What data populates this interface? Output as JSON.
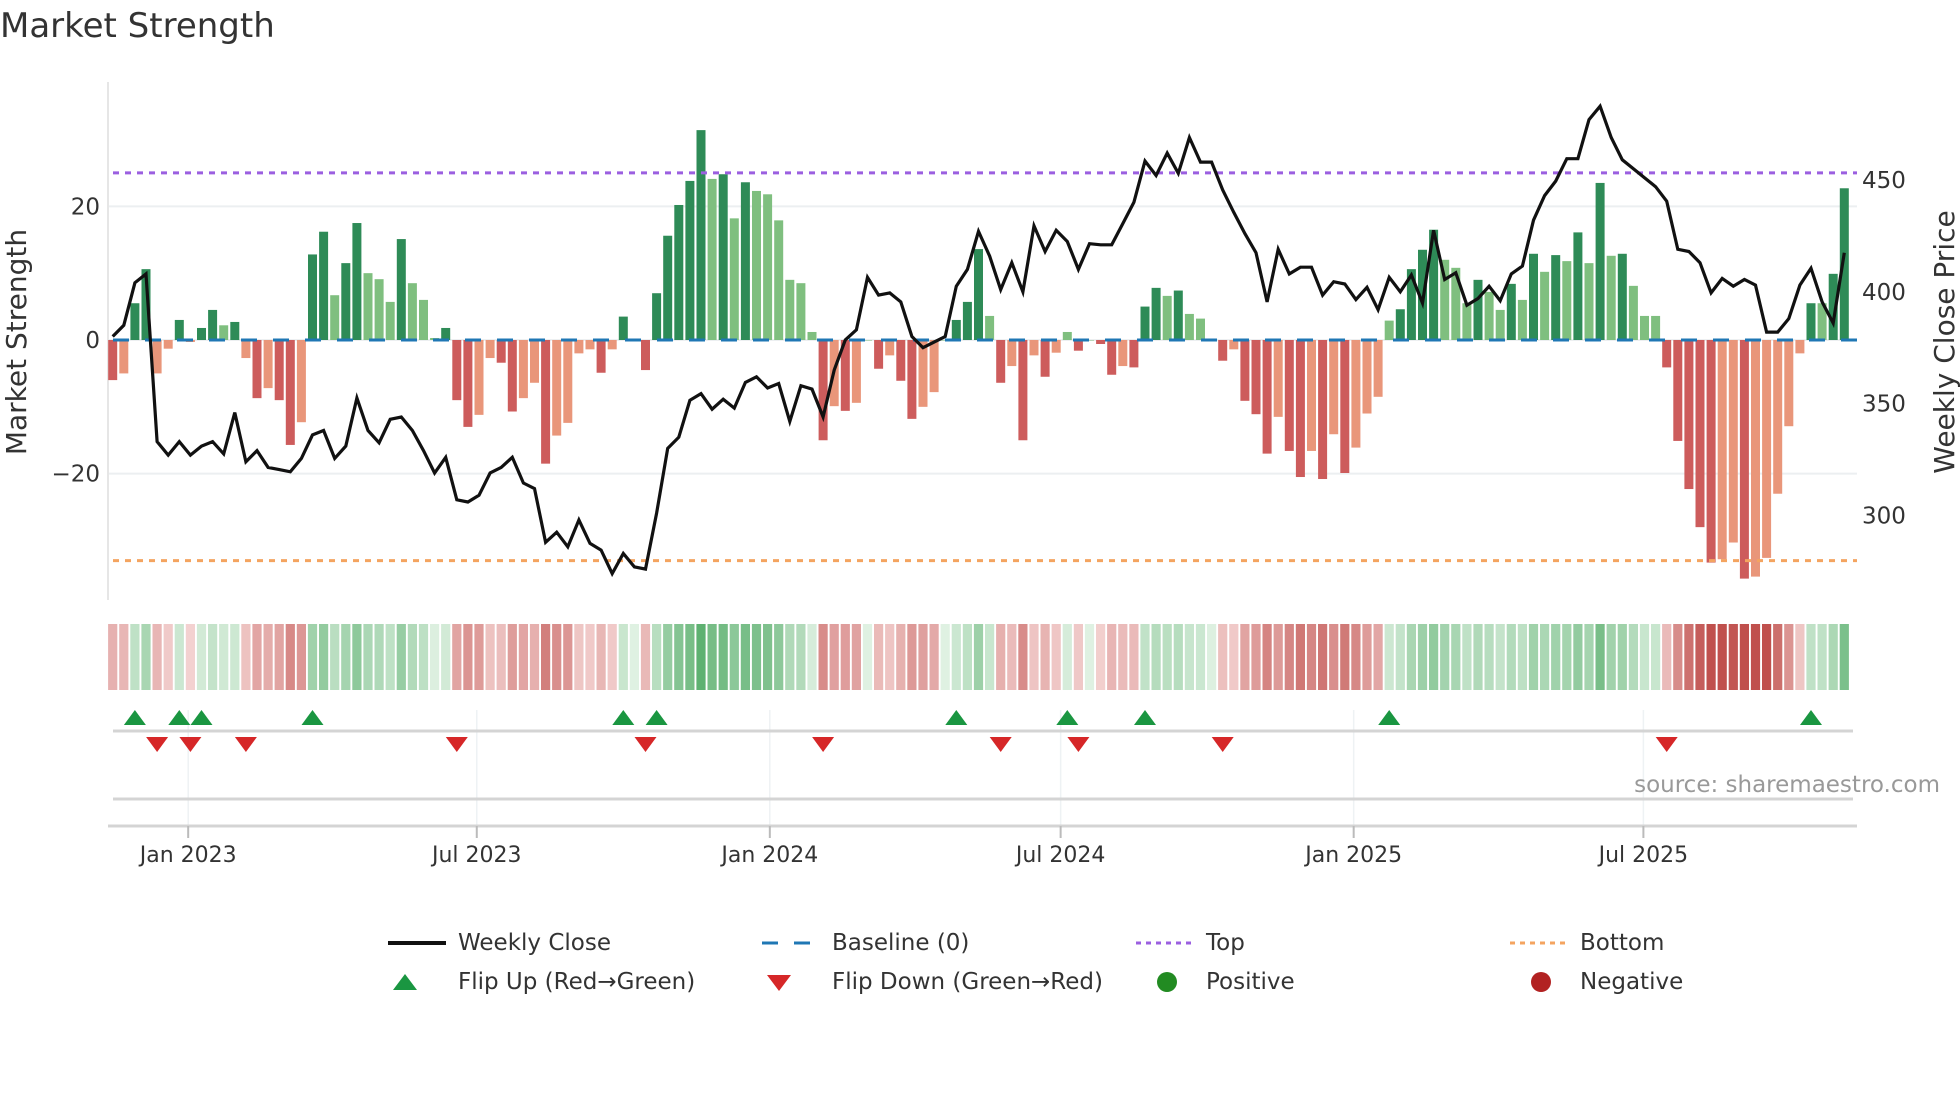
{
  "title": "Market Strength",
  "source": "source: sharemaestro.com",
  "legend": {
    "weekly_close": "Weekly Close",
    "baseline": "Baseline (0)",
    "top": "Top",
    "bottom": "Bottom",
    "flip_up": "Flip Up (Red→Green)",
    "flip_down": "Flip Down (Green→Red)",
    "positive": "Positive",
    "negative": "Negative"
  },
  "colors": {
    "strong_green": "#2e8b57",
    "weak_green": "#7fbf7f",
    "strong_red": "#cd5c5c",
    "weak_red": "#e9967a",
    "close_line": "#111111",
    "baseline": "#1f77b4",
    "top": "#9b5fe0",
    "bottom": "#f4a460",
    "flip_up": "#1a9641",
    "flip_down": "#d62728",
    "positive": "#228b22",
    "negative": "#b22222"
  },
  "chart_data": {
    "type": "bar",
    "title": "Market Strength",
    "ylabel": "Market Strength",
    "y2label": "Weekly Close Price",
    "ylim": [
      -38.9,
      38.6
    ],
    "y2lim": [
      262.2,
      493.8
    ],
    "yticks": [
      {
        "value": 20,
        "label": "20"
      },
      {
        "value": 0,
        "label": "0"
      },
      {
        "value": -20,
        "label": "−20"
      }
    ],
    "y2ticks": [
      {
        "value": 450,
        "label": "450"
      },
      {
        "value": 400,
        "label": "400"
      },
      {
        "value": 350,
        "label": "350"
      },
      {
        "value": 300,
        "label": "300"
      }
    ],
    "xticks": [
      {
        "week": 6.8,
        "label": "Jan 2023"
      },
      {
        "week": 32.8,
        "label": "Jul 2023"
      },
      {
        "week": 59.2,
        "label": "Jan 2024"
      },
      {
        "week": 85.4,
        "label": "Jul 2024"
      },
      {
        "week": 111.8,
        "label": "Jan 2025"
      },
      {
        "week": 137.9,
        "label": "Jul 2025"
      }
    ],
    "top_threshold": 25,
    "bottom_threshold": -33,
    "strength": [
      -6,
      -5,
      5.5,
      10.6,
      -5,
      -1.3,
      3,
      -0.3,
      1.8,
      4.5,
      2.2,
      2.7,
      -2.7,
      -8.7,
      -7.2,
      -9,
      -15.7,
      -12.3,
      12.8,
      16.2,
      6.7,
      11.5,
      17.5,
      10,
      9.1,
      5.7,
      15.1,
      8.5,
      6,
      0.3,
      1.8,
      -9,
      -13,
      -11.2,
      -2.7,
      -3.4,
      -10.7,
      -8.7,
      -6.4,
      -18.5,
      -14.3,
      -12.4,
      -2,
      -1.4,
      -4.9,
      -1.4,
      3.5,
      0,
      -4.5,
      7,
      15.6,
      20.2,
      23.8,
      31.4,
      24.1,
      24.8,
      18.2,
      23.6,
      22.3,
      21.8,
      17.9,
      9,
      8.5,
      1.2,
      -15,
      -9.9,
      -10.6,
      -9.4,
      0,
      -4.3,
      -2.3,
      -6.1,
      -11.8,
      -10,
      -7.8,
      0,
      3,
      5.7,
      13.6,
      3.6,
      -6.4,
      -3.9,
      -15,
      -2.3,
      -5.5,
      -1.9,
      1.2,
      -1.6,
      0,
      -0.6,
      -5.2,
      -3.9,
      -4.1,
      5,
      7.8,
      6.6,
      7.4,
      3.9,
      3.2,
      0.2,
      -3.1,
      -1.4,
      -9.1,
      -11.1,
      -17,
      -11.5,
      -16.6,
      -20.5,
      -16.6,
      -20.8,
      -14.1,
      -19.9,
      -16.1,
      -11,
      -8.5,
      2.9,
      4.6,
      10.6,
      13.5,
      16.5,
      12,
      10.8,
      5.5,
      9,
      7.2,
      4.5,
      8.4,
      6,
      12.9,
      10.2,
      12.7,
      11.8,
      16.1,
      11.5,
      23.5,
      12.6,
      12.9,
      8.1,
      3.6,
      3.6,
      -4.1,
      -15.1,
      -22.3,
      -28,
      -33.3,
      -32.8,
      -30.3,
      -35.7,
      -35.4,
      -32.6,
      -23,
      -12.9,
      -2,
      5.5,
      5.5,
      9.9,
      22.7
    ],
    "weekly_close": [
      380,
      385,
      404,
      408,
      333,
      327,
      333,
      327,
      331,
      333,
      327.5,
      346,
      324,
      329,
      321.5,
      320.5,
      319.5,
      325.5,
      336,
      338,
      325.5,
      331,
      352.5,
      338,
      332.5,
      343,
      344,
      338,
      329,
      319,
      326,
      307,
      306,
      309,
      319,
      321.5,
      326,
      314.5,
      312,
      288,
      292.5,
      286,
      298,
      287.5,
      284.5,
      274,
      283,
      277,
      276,
      301,
      330,
      335,
      351.5,
      354.5,
      347.5,
      352,
      348,
      359.5,
      362,
      357,
      359,
      342,
      358,
      356.5,
      344,
      365,
      378.5,
      383,
      406.5,
      398.5,
      399.5,
      395.5,
      380,
      375,
      377.5,
      380,
      402.5,
      410,
      427,
      416,
      401,
      413,
      400,
      429.5,
      418,
      427.5,
      422.5,
      410,
      421.5,
      421,
      421,
      430.5,
      440,
      458.5,
      452,
      462,
      453,
      469,
      458,
      458,
      445.5,
      435.5,
      426,
      417.5,
      395.5,
      419,
      408,
      411,
      411,
      398.5,
      404.5,
      403.5,
      396.5,
      402,
      392,
      406.5,
      400,
      407.5,
      395,
      427.5,
      405.5,
      408.5,
      394,
      397,
      402.5,
      396,
      408,
      411.5,
      432,
      443,
      449.5,
      459.5,
      459.5,
      477,
      483,
      469,
      459,
      455,
      451,
      447,
      440.5,
      419,
      418,
      413,
      399.5,
      406,
      402.5,
      405.5,
      403,
      382,
      382,
      388,
      403,
      410.5,
      395.5,
      386,
      417.5
    ],
    "flip_up_weeks": [
      2,
      6,
      8,
      18,
      46,
      49,
      76,
      86,
      93,
      115,
      153
    ],
    "flip_down_weeks": [
      4,
      7,
      12,
      31,
      48,
      64,
      80,
      87,
      100,
      140
    ]
  }
}
